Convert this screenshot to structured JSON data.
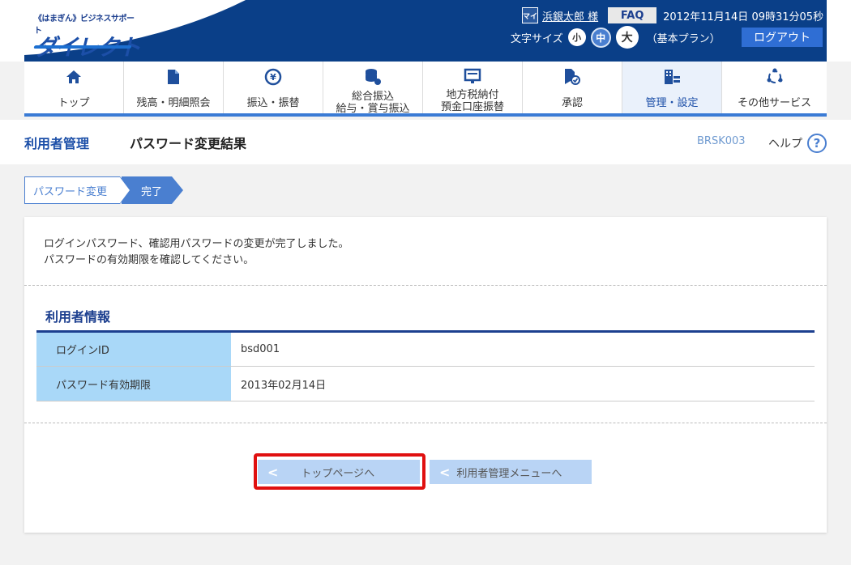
{
  "header": {
    "logo_small": "《はまぎん》ビジネスサポート",
    "logo_big": "ダイレクト",
    "user_icon_text": "マイ",
    "user_name": "浜銀太郎 様",
    "faq_label": "FAQ",
    "datetime": "2012年11月14日 09時31分05秒",
    "font_size_label": "文字サイズ",
    "font_small": "小",
    "font_mid": "中",
    "font_big": "大",
    "plan": "（基本プラン）",
    "logout_label": "ログアウト"
  },
  "nav": {
    "items": [
      {
        "icon": "home-icon",
        "glyph": "⌂",
        "label": "トップ",
        "label2": ""
      },
      {
        "icon": "document-icon",
        "glyph": "▮",
        "label": "残高・明細照会",
        "label2": ""
      },
      {
        "icon": "yen-transfer-icon",
        "glyph": "¥",
        "label": "振込・振替",
        "label2": ""
      },
      {
        "icon": "database-icon",
        "glyph": "≡",
        "label": "総合振込",
        "label2": "給与・賞与振込"
      },
      {
        "icon": "tax-card-icon",
        "glyph": "▭",
        "label": "地方税納付",
        "label2": "預金口座振替"
      },
      {
        "icon": "approval-icon",
        "glyph": "✔",
        "label": "承認",
        "label2": ""
      },
      {
        "icon": "management-icon",
        "glyph": "▦",
        "label": "管理・設定",
        "label2": ""
      },
      {
        "icon": "other-services-icon",
        "glyph": "◌",
        "label": "その他サービス",
        "label2": ""
      }
    ]
  },
  "title": {
    "category": "利用者管理",
    "main": "パスワード変更結果",
    "code": "BRSK003",
    "help": "ヘルプ",
    "help_icon": "?"
  },
  "steps": {
    "step1": "パスワード変更",
    "step2": "完了"
  },
  "message": {
    "line1": "ログインパスワード、確認用パスワードの変更が完了しました。",
    "line2": "パスワードの有効期限を確認してください。"
  },
  "user_info": {
    "title": "利用者情報",
    "rows": [
      {
        "key": "ログインID",
        "value": "bsd001"
      },
      {
        "key": "パスワード有効期限",
        "value": "2013年02月14日"
      }
    ]
  },
  "buttons": {
    "top_page": "トップページへ",
    "user_menu": "利用者管理メニューへ",
    "chevron": "<"
  }
}
